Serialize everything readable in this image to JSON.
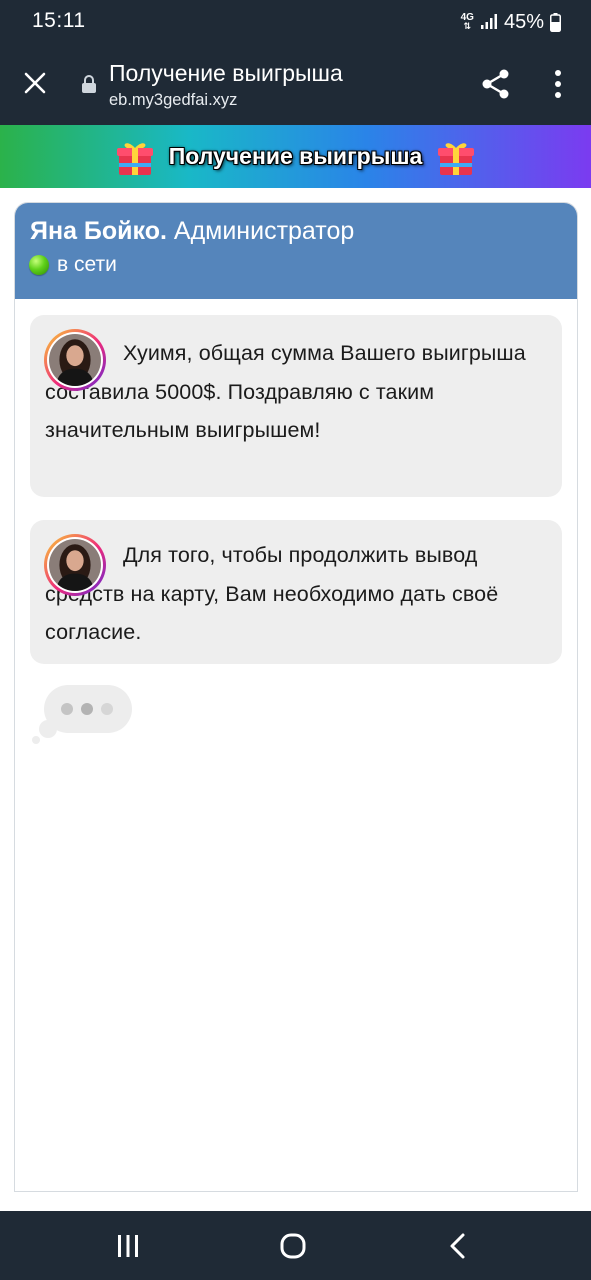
{
  "status_bar": {
    "time": "15:11",
    "network": "4G",
    "battery": "45%"
  },
  "browser": {
    "title": "Получение выигрыша",
    "url": "eb.my3gedfai.xyz"
  },
  "banner": {
    "text": "Получение выигрыша"
  },
  "chat": {
    "sender_name": "Яна Бойко.",
    "sender_role": "Администратор",
    "status": "в сети",
    "messages": [
      {
        "text": "Хуимя, общая сумма Вашего выигрыша составила 5000$. Поздравляю с таким значительным выигрышем!"
      },
      {
        "text": "Для того, чтобы продолжить вывод средств на карту, Вам необходимо дать своё согласие."
      }
    ]
  },
  "colors": {
    "system_bar": "#1f2a36",
    "chat_header": "#5585bb",
    "bubble": "#eeeeee",
    "online": "#5fd11a"
  }
}
